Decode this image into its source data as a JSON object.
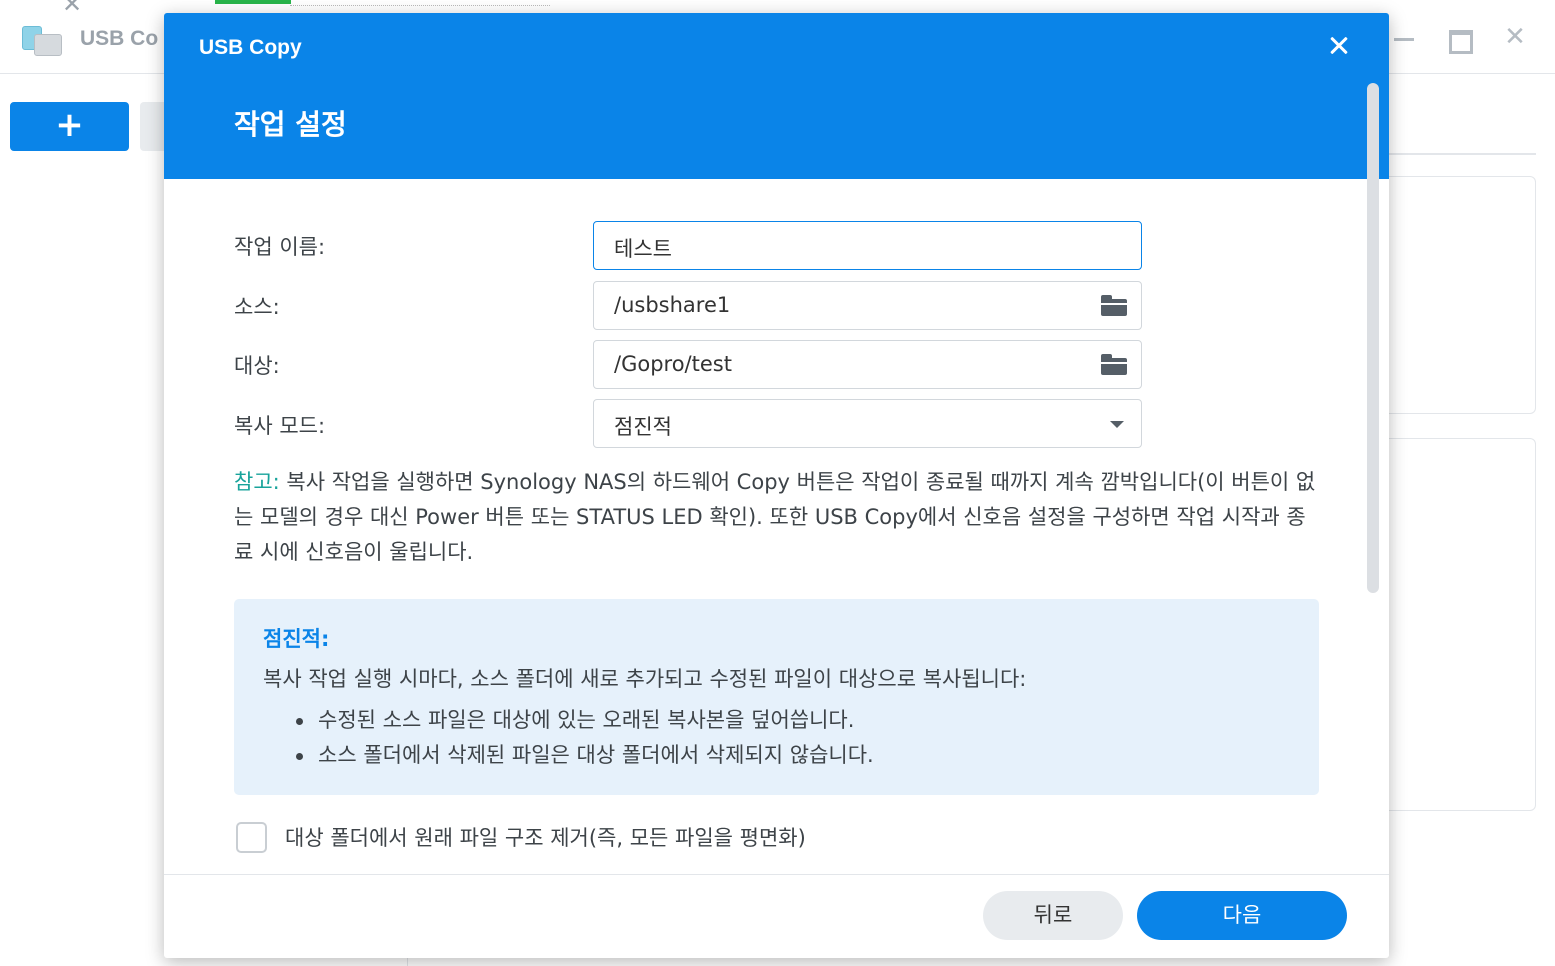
{
  "background_app": {
    "title": "USB Co",
    "add_button": "+"
  },
  "dialog": {
    "app_title": "USB Copy",
    "heading": "작업 설정",
    "fields": {
      "task_name": {
        "label": "작업 이름:",
        "value": "테스트"
      },
      "source": {
        "label": "소스:",
        "value": "/usbshare1"
      },
      "destination": {
        "label": "대상:",
        "value": "/Gopro/test"
      },
      "copy_mode": {
        "label": "복사 모드:",
        "value": "점진적"
      }
    },
    "note": {
      "label": "참고:",
      "text": " 복사 작업을 실행하면 Synology NAS의 하드웨어 Copy 버튼은 작업이 종료될 때까지 계속 깜박입니다(이 버튼이 없는 모델의 경우 대신 Power 버튼 또는 STATUS LED 확인). 또한 USB Copy에서 신호음 설정을 구성하면 작업 시작과 종료 시에 신호음이 울립니다."
    },
    "info": {
      "title": "점진적:",
      "description": "복사 작업 실행 시마다, 소스 폴더에 새로 추가되고 수정된 파일이 대상으로 복사됩니다:",
      "bullets": [
        "수정된 소스 파일은 대상에 있는 오래된 복사본을 덮어씁니다.",
        "소스 폴더에서 삭제된 파일은 대상 폴더에서 삭제되지 않습니다."
      ]
    },
    "checkbox": {
      "label": "대상 폴더에서 원래 파일 구조 제거(즉, 모든 파일을 평면화)",
      "checked": false
    },
    "buttons": {
      "back": "뒤로",
      "next": "다음"
    }
  },
  "colors": {
    "accent": "#0a84e8",
    "note_label": "#18a39b",
    "info_bg": "#e6f1fb"
  }
}
